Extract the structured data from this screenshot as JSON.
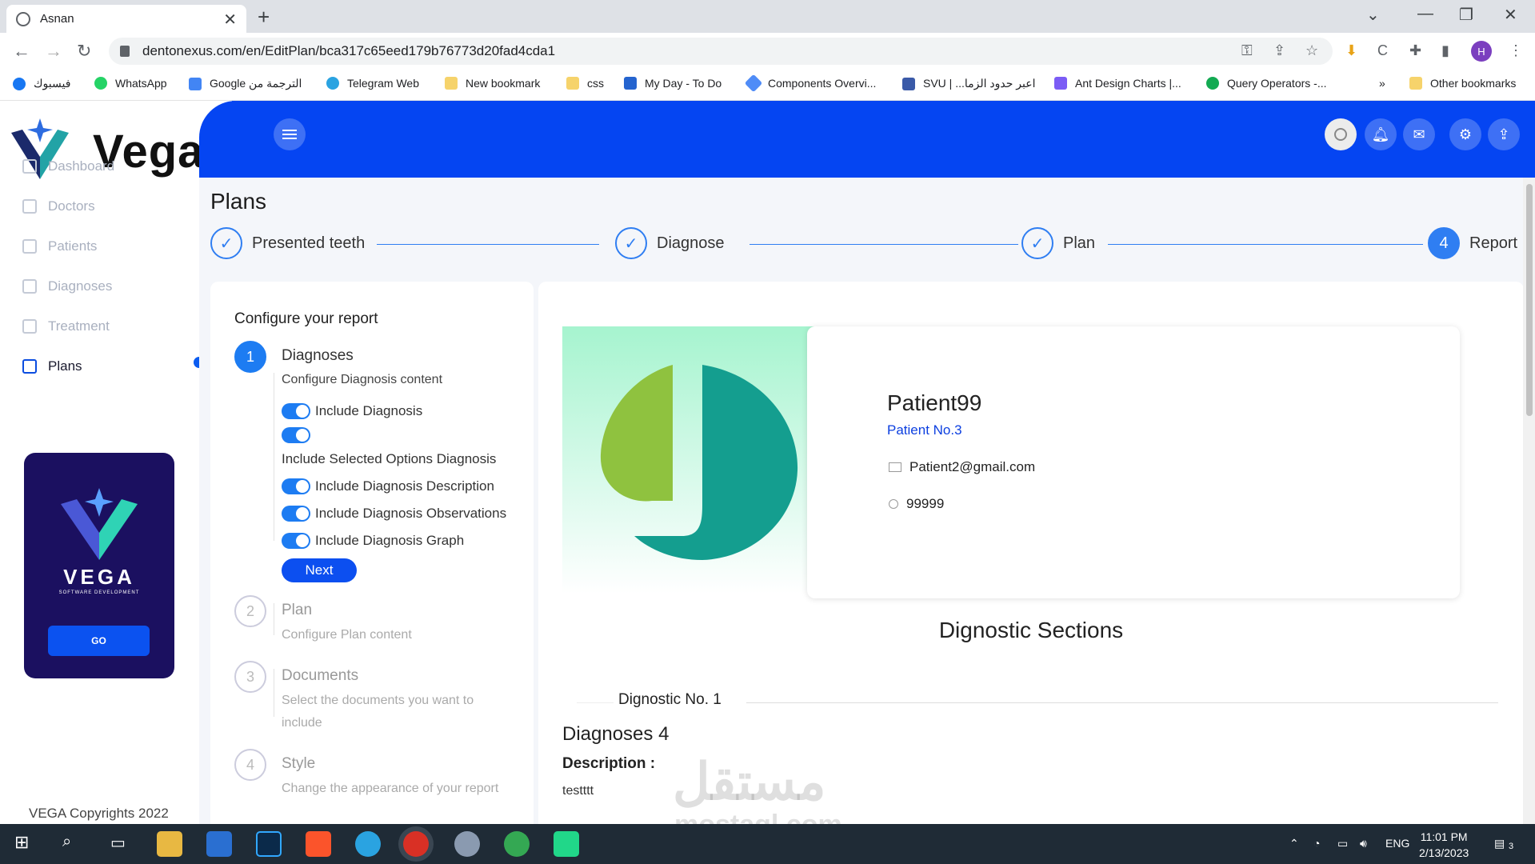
{
  "browser": {
    "tab_title": "Asnan",
    "url": "dentonexus.com/en/EditPlan/bca317c65eed179b76773d20fad4cda1",
    "profile_initial": "H",
    "bookmarks": [
      "فيسبوك",
      "WhatsApp",
      "Google الترجمة من",
      "Telegram Web",
      "New bookmark",
      "css",
      "My Day - To Do",
      "Components Overvi...",
      "SVU | ...اعبر حدود الزما",
      "Ant Design Charts |...",
      "Query Operators -..."
    ],
    "bookmarks_more": "»",
    "other_bookmarks": "Other bookmarks"
  },
  "sidebar": {
    "brand": "Vega",
    "items": [
      {
        "label": "Dashboard"
      },
      {
        "label": "Doctors"
      },
      {
        "label": "Patients"
      },
      {
        "label": "Diagnoses"
      },
      {
        "label": "Treatment"
      },
      {
        "label": "Plans"
      }
    ],
    "promo_word": "VEGA",
    "promo_sub": "SOFTWARE DEVELOPMENT",
    "promo_button": "GO",
    "copyright": "VEGA Copyrights 2022"
  },
  "page": {
    "title": "Plans",
    "steps": [
      {
        "label": "Presented teeth",
        "mark": "✓"
      },
      {
        "label": "Diagnose",
        "mark": "✓"
      },
      {
        "label": "Plan",
        "mark": "✓"
      },
      {
        "label": "Report",
        "mark": "4"
      }
    ]
  },
  "config": {
    "title": "Configure your report",
    "steps": [
      {
        "num": "1",
        "title": "Diagnoses",
        "desc": "Configure Diagnosis content"
      },
      {
        "num": "2",
        "title": "Plan",
        "desc": "Configure Plan content"
      },
      {
        "num": "3",
        "title": "Documents",
        "desc": "Select the documents you want to include"
      },
      {
        "num": "4",
        "title": "Style",
        "desc": "Change the appearance of your report"
      }
    ],
    "toggles": [
      "Include Diagnosis",
      "",
      "Include Diagnosis Description",
      "Include Diagnosis Observations",
      "Include Diagnosis Graph"
    ],
    "selected_options_label": "Include Selected Options Diagnosis",
    "next_button": "Next"
  },
  "report": {
    "patient_name": "Patient99",
    "patient_no": "Patient No.3",
    "email": "Patient2@gmail.com",
    "phone": "99999",
    "sections_title": "Dignostic Sections",
    "diagnostic_no": "Dignostic No. 1",
    "diagnosis_name": "Diagnoses 4",
    "description_label": "Description :",
    "description_value": "testttt"
  },
  "watermark": {
    "ar": "مستقل",
    "en": "mostaql.com"
  },
  "taskbar": {
    "lang": "ENG",
    "time": "11:01 PM",
    "date": "2/13/2023",
    "notif_count": "3"
  },
  "colors": {
    "primary": "#0545f2",
    "accent": "#1d7cf2",
    "promo_bg": "#1b1060"
  }
}
